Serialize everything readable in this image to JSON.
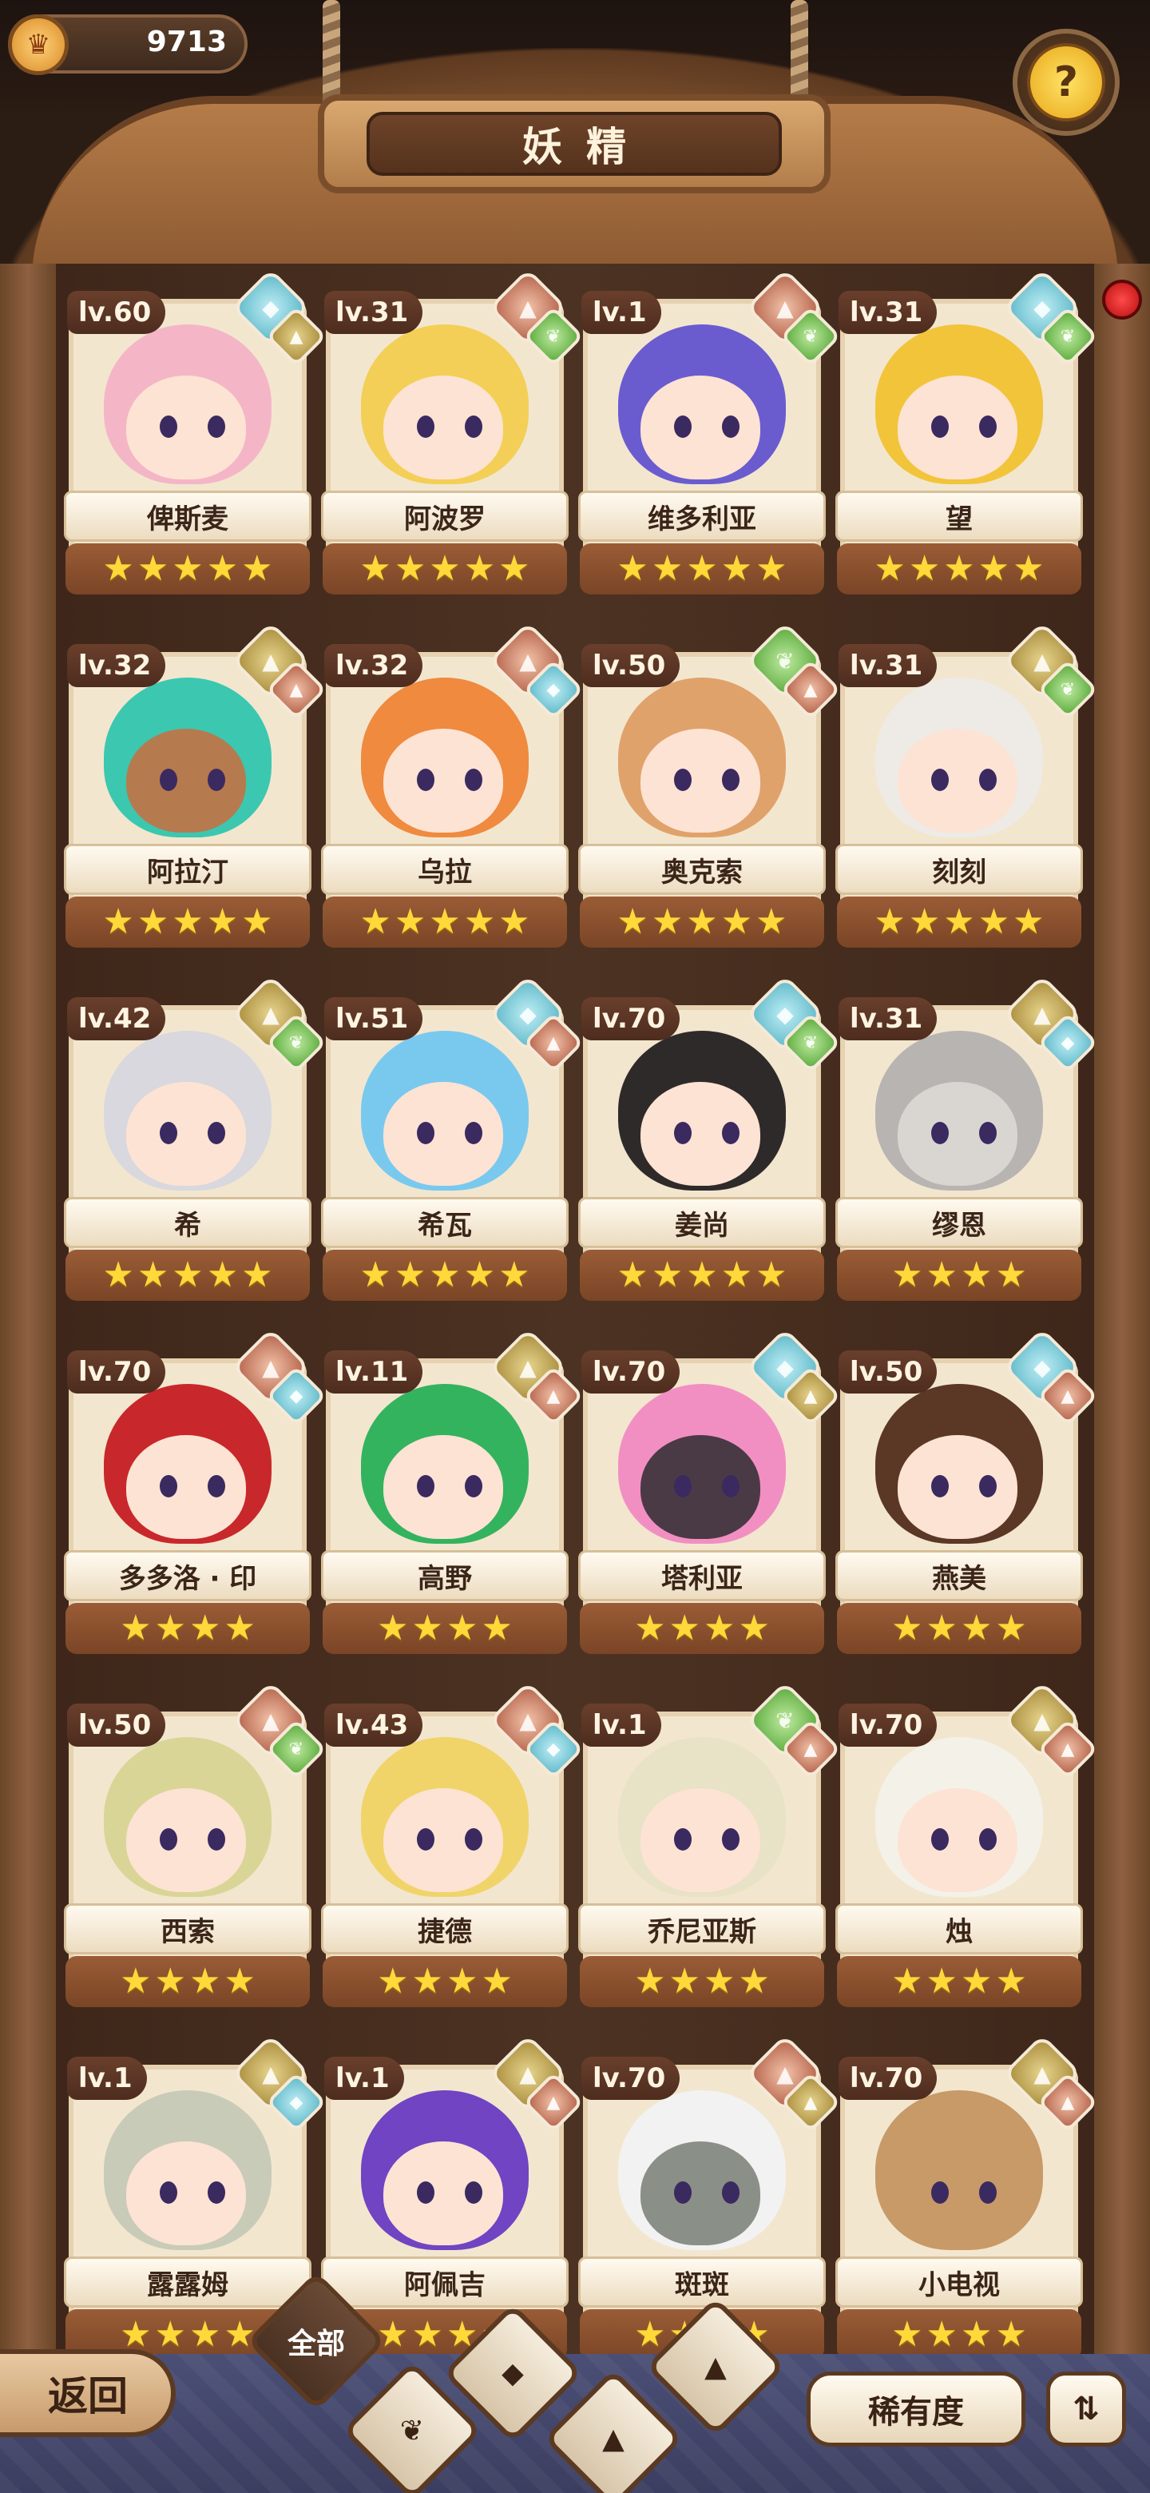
{
  "currency": {
    "value": "9713",
    "icon": "crown-coin-icon"
  },
  "header": {
    "title": "妖精"
  },
  "help": {
    "label": "?"
  },
  "fairies": [
    {
      "level": "lv.60",
      "name": "俾斯麦",
      "element": "water",
      "sub": "earth",
      "stars": 5,
      "hair": "#f4b6c6",
      "skin": "#fde3d3"
    },
    {
      "level": "lv.31",
      "name": "阿波罗",
      "element": "fire",
      "sub": "leaf",
      "stars": 5,
      "hair": "#f3cf57",
      "skin": "#fde3d3"
    },
    {
      "level": "lv.1",
      "name": "维多利亚",
      "element": "fire",
      "sub": "leaf",
      "stars": 5,
      "hair": "#6a5ccf",
      "skin": "#fde3d3"
    },
    {
      "level": "lv.31",
      "name": "望",
      "element": "water",
      "sub": "leaf",
      "stars": 5,
      "hair": "#f2c43a",
      "skin": "#fde3d3"
    },
    {
      "level": "lv.32",
      "name": "阿拉汀",
      "element": "earth",
      "sub": "fire",
      "stars": 5,
      "hair": "#3cc7b0",
      "skin": "#b67a4f"
    },
    {
      "level": "lv.32",
      "name": "乌拉",
      "element": "fire",
      "sub": "water",
      "stars": 5,
      "hair": "#ef8a3f",
      "skin": "#fde3d3"
    },
    {
      "level": "lv.50",
      "name": "奥克索",
      "element": "leaf",
      "sub": "fire",
      "stars": 5,
      "hair": "#e0a26b",
      "skin": "#fde3d3"
    },
    {
      "level": "lv.31",
      "name": "刻刻",
      "element": "earth",
      "sub": "leaf",
      "stars": 5,
      "hair": "#eeeae6",
      "skin": "#fde3d3"
    },
    {
      "level": "lv.42",
      "name": "希",
      "element": "earth",
      "sub": "leaf",
      "stars": 5,
      "hair": "#d8d8de",
      "skin": "#fde3d3"
    },
    {
      "level": "lv.51",
      "name": "希瓦",
      "element": "water",
      "sub": "fire",
      "stars": 5,
      "hair": "#79c9ef",
      "skin": "#fde3d3"
    },
    {
      "level": "lv.70",
      "name": "姜尚",
      "element": "water",
      "sub": "leaf",
      "stars": 5,
      "hair": "#2f2a2a",
      "skin": "#fde3d3"
    },
    {
      "level": "lv.31",
      "name": "缪恩",
      "element": "earth",
      "sub": "water",
      "stars": 4,
      "hair": "#b7b4b2",
      "skin": "#d9d6d2"
    },
    {
      "level": "lv.70",
      "name": "多多洛 · 印",
      "element": "fire",
      "sub": "water",
      "stars": 4,
      "hair": "#c8282b",
      "skin": "#fde3d3"
    },
    {
      "level": "lv.11",
      "name": "高野",
      "element": "earth",
      "sub": "fire",
      "stars": 4,
      "hair": "#33b35e",
      "skin": "#fde3d3"
    },
    {
      "level": "lv.70",
      "name": "塔利亚",
      "element": "water",
      "sub": "earth",
      "stars": 4,
      "hair": "#f28fc2",
      "skin": "#4a3a45"
    },
    {
      "level": "lv.50",
      "name": "燕美",
      "element": "water",
      "sub": "fire",
      "stars": 4,
      "hair": "#5b3726",
      "skin": "#fde3d3"
    },
    {
      "level": "lv.50",
      "name": "西索",
      "element": "fire",
      "sub": "leaf",
      "stars": 4,
      "hair": "#d9d597",
      "skin": "#fde3d3"
    },
    {
      "level": "lv.43",
      "name": "捷德",
      "element": "fire",
      "sub": "water",
      "stars": 4,
      "hair": "#f0d46a",
      "skin": "#fde3d3"
    },
    {
      "level": "lv.1",
      "name": "乔尼亚斯",
      "element": "leaf",
      "sub": "fire",
      "stars": 4,
      "hair": "#e8e2c7",
      "skin": "#fde3d3"
    },
    {
      "level": "lv.70",
      "name": "烛",
      "element": "earth",
      "sub": "fire",
      "stars": 4,
      "hair": "#f4f1e9",
      "skin": "#fde3d3"
    },
    {
      "level": "lv.1",
      "name": "露露姆",
      "element": "earth",
      "sub": "water",
      "stars": 4,
      "hair": "#c8cbb8",
      "skin": "#fde3d3"
    },
    {
      "level": "lv.1",
      "name": "阿佩吉",
      "element": "earth",
      "sub": "fire",
      "stars": 4,
      "hair": "#7044c2",
      "skin": "#fde3d3"
    },
    {
      "level": "lv.70",
      "name": "斑斑",
      "element": "fire",
      "sub": "earth",
      "stars": 4,
      "hair": "#f2f2f2",
      "skin": "#8a8f87"
    },
    {
      "level": "lv.70",
      "name": "小电视",
      "element": "earth",
      "sub": "fire",
      "stars": 4,
      "hair": "#c79a68",
      "skin": "#c79a68"
    }
  ],
  "bottom": {
    "back_label": "返回",
    "filters": [
      {
        "label": "全部",
        "icon": "all-filter",
        "active": true
      },
      {
        "label": "",
        "icon": "leaf-element-icon",
        "active": false
      },
      {
        "label": "",
        "icon": "water-element-icon",
        "active": false
      },
      {
        "label": "",
        "icon": "earth-element-icon",
        "active": false
      },
      {
        "label": "",
        "icon": "fire-element-icon",
        "active": false
      }
    ],
    "sort_label": "稀有度",
    "order_icon": "sort-order-icon"
  },
  "colors": {
    "water": "#5fb8c9",
    "earth": "#a88c3b",
    "fire": "#b4624a",
    "leaf": "#5aaa3c",
    "star": "#ffd83a"
  }
}
